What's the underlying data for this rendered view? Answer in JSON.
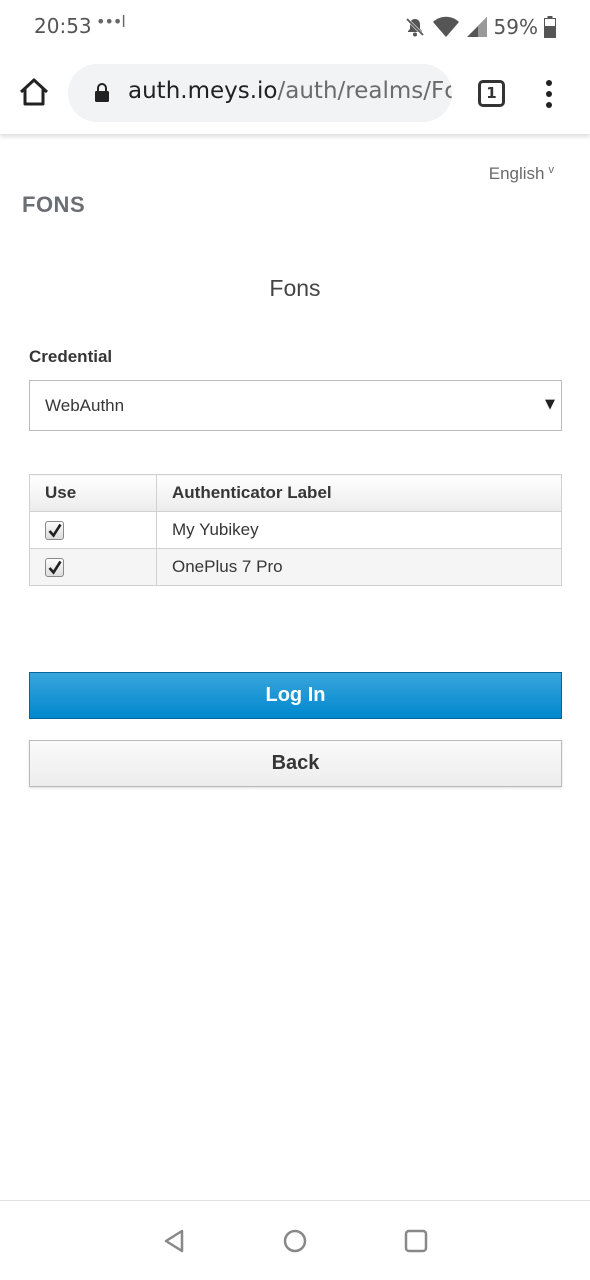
{
  "status_bar": {
    "time": "20:53",
    "dots": "•••l",
    "battery_percent": "59%"
  },
  "browser": {
    "url_host": "auth.meys.io",
    "url_path": "/auth/realms/Fc",
    "tab_count": "1"
  },
  "page": {
    "language": "English",
    "language_caret": "v",
    "realm_name": "FONS",
    "title": "Fons",
    "credential_label": "Credential",
    "credential_selected": "WebAuthn",
    "credential_caret": "▼",
    "table": {
      "headers": [
        "Use",
        "Authenticator Label"
      ],
      "rows": [
        {
          "use": true,
          "label": "My Yubikey"
        },
        {
          "use": true,
          "label": "OnePlus 7 Pro"
        }
      ]
    },
    "login_button": "Log In",
    "back_button": "Back"
  },
  "colors": {
    "primary": "#0088ce",
    "realm_text": "#6b6f74"
  }
}
